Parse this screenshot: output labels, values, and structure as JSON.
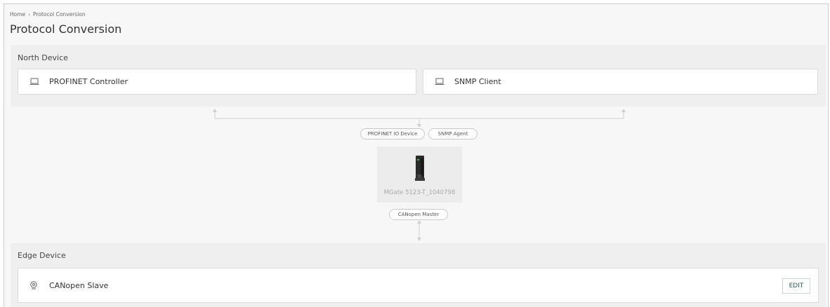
{
  "breadcrumb": {
    "home": "Home",
    "separator": "›",
    "current": "Protocol Conversion"
  },
  "page": {
    "title": "Protocol Conversion"
  },
  "north": {
    "title": "North Device",
    "devices": [
      {
        "label": "PROFINET Controller",
        "icon": "laptop-icon"
      },
      {
        "label": "SNMP Client",
        "icon": "laptop-icon"
      }
    ]
  },
  "gateway": {
    "north_protocols": [
      "PROFINET IO Device",
      "SNMP Agent"
    ],
    "device_name": "MGate 5123-T_1040798",
    "device_icon": "gateway-device-icon",
    "south_protocol": "CANopen Master"
  },
  "edge": {
    "title": "Edge Device",
    "devices": [
      {
        "label": "CANopen Slave",
        "icon": "location-pin-icon",
        "action": "EDIT"
      }
    ]
  },
  "colors": {
    "accent": "#2a5a62",
    "section_bg": "#efefef",
    "card_border": "#dcdcdc"
  }
}
